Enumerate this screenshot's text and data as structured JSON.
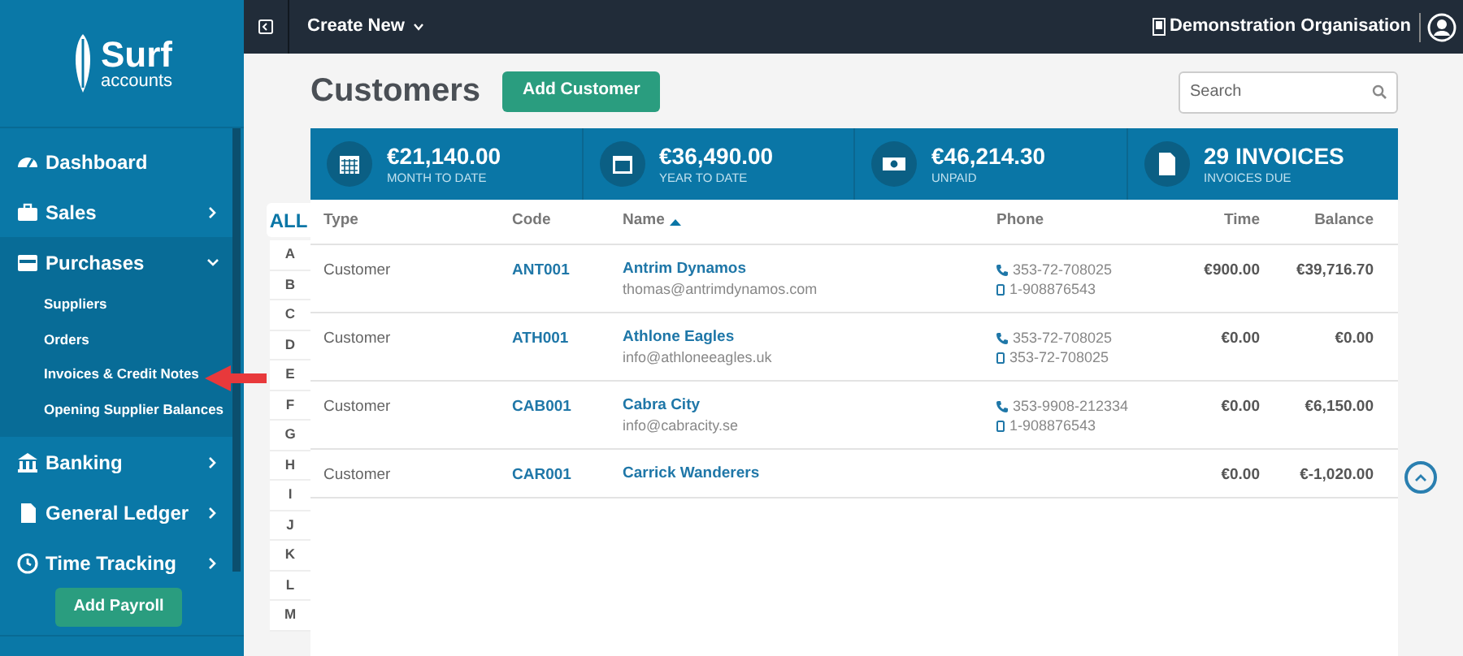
{
  "sidebar": {
    "logo": {
      "name": "Surf",
      "tagline": "accounts"
    },
    "nav": [
      {
        "label": "Dashboard",
        "kind": "link"
      },
      {
        "label": "Sales",
        "kind": "group",
        "expanded": false
      },
      {
        "label": "Purchases",
        "kind": "group",
        "expanded": true,
        "children": [
          {
            "label": "Suppliers"
          },
          {
            "label": "Orders"
          },
          {
            "label": "Invoices & Credit Notes"
          },
          {
            "label": "Opening Supplier Balances"
          }
        ]
      },
      {
        "label": "Banking",
        "kind": "group",
        "expanded": false
      },
      {
        "label": "General Ledger",
        "kind": "group",
        "expanded": false
      },
      {
        "label": "Time Tracking",
        "kind": "group",
        "expanded": false
      }
    ],
    "button": "Add Payroll"
  },
  "topbar": {
    "menu": "Create New",
    "organisation": "Demonstration Organisation"
  },
  "page": {
    "title": "Customers",
    "add_button": "Add Customer",
    "search": {
      "placeholder": "Search"
    }
  },
  "stats": [
    {
      "value": "€21,140.00",
      "label": "MONTH TO DATE"
    },
    {
      "value": "€36,490.00",
      "label": "YEAR TO DATE"
    },
    {
      "value": "€46,214.30",
      "label": "UNPAID"
    },
    {
      "value": "29 INVOICES",
      "label": "INVOICES DUE"
    }
  ],
  "alphabet": [
    {
      "label": "ALL",
      "selected": true
    },
    {
      "label": "A",
      "selected": false
    },
    {
      "label": "B",
      "selected": false
    },
    {
      "label": "C",
      "selected": false
    },
    {
      "label": "D",
      "selected": false
    },
    {
      "label": "E",
      "selected": false
    },
    {
      "label": "F",
      "selected": false
    },
    {
      "label": "G",
      "selected": false
    },
    {
      "label": "H",
      "selected": false
    },
    {
      "label": "I",
      "selected": false
    },
    {
      "label": "J",
      "selected": false
    },
    {
      "label": "K",
      "selected": false
    },
    {
      "label": "L",
      "selected": false
    },
    {
      "label": "M",
      "selected": false
    }
  ],
  "table": {
    "columns": [
      {
        "label": "Type",
        "sorted": false
      },
      {
        "label": "Code",
        "sorted": false
      },
      {
        "label": "Name",
        "sorted": true
      },
      {
        "label": "Phone",
        "sorted": false
      },
      {
        "label": "Time",
        "sorted": false
      },
      {
        "label": "Balance",
        "sorted": false
      }
    ],
    "rows": [
      {
        "type": "Customer",
        "code": "ANT001",
        "name": "Antrim Dynamos",
        "email": "thomas@antrimdynamos.com",
        "phones": [
          {
            "kind": "landline",
            "number": "353-72-708025"
          },
          {
            "kind": "mobile",
            "number": "1-908876543"
          }
        ],
        "time": "€900.00",
        "balance": "€39,716.70"
      },
      {
        "type": "Customer",
        "code": "ATH001",
        "name": "Athlone Eagles",
        "email": "info@athloneeagles.uk",
        "phones": [
          {
            "kind": "landline",
            "number": "353-72-708025"
          },
          {
            "kind": "mobile",
            "number": "353-72-708025"
          }
        ],
        "time": "€0.00",
        "balance": "€0.00"
      },
      {
        "type": "Customer",
        "code": "CAB001",
        "name": "Cabra City",
        "email": "info@cabracity.se",
        "phones": [
          {
            "kind": "landline",
            "number": "353-9908-212334"
          },
          {
            "kind": "mobile",
            "number": "1-908876543"
          }
        ],
        "time": "€0.00",
        "balance": "€6,150.00"
      },
      {
        "type": "Customer",
        "code": "CAR001",
        "name": "Carrick Wanderers",
        "phones": [],
        "time": "€0.00",
        "balance": "€-1,020.00"
      }
    ]
  }
}
